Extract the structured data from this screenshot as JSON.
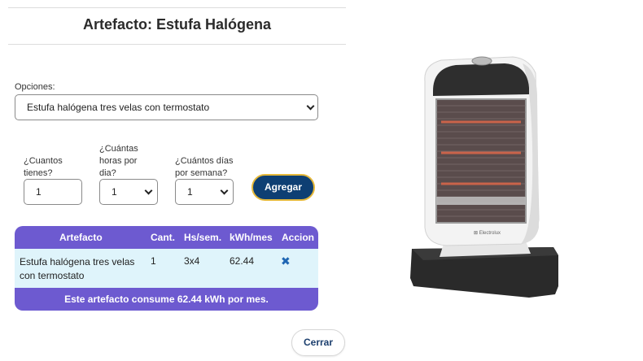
{
  "modal": {
    "title": "Artefacto: Estufa Halógena",
    "options_label": "Opciones:",
    "options_selected": "Estufa halógena tres velas con termostato",
    "qty_label": "¿Cuantos tienes?",
    "qty_value": "1",
    "hours_label": "¿Cuántas horas por dia?",
    "hours_value": "1",
    "days_label": "¿Cuántos días por semana?",
    "days_value": "1",
    "add_button": "Agregar",
    "close_button": "Cerrar"
  },
  "table": {
    "headers": [
      "Artefacto",
      "Cant.",
      "Hs/sem.",
      "kWh/mes",
      "Accion"
    ],
    "rows": [
      {
        "artefacto": "Estufa halógena tres velas con termostato",
        "cant": "1",
        "hs": "3x4",
        "kwh": "62.44"
      }
    ],
    "footer": "Este artefacto consume 62.44 kWh por mes."
  },
  "product_image": {
    "brand": "Electrolux",
    "icon": "heater-image"
  },
  "colors": {
    "header": "#6d5ad0",
    "row": "#dff4fb",
    "primary_button": "#0e3f73",
    "button_border": "#e5b83a",
    "delete_icon": "#1f66b3"
  }
}
